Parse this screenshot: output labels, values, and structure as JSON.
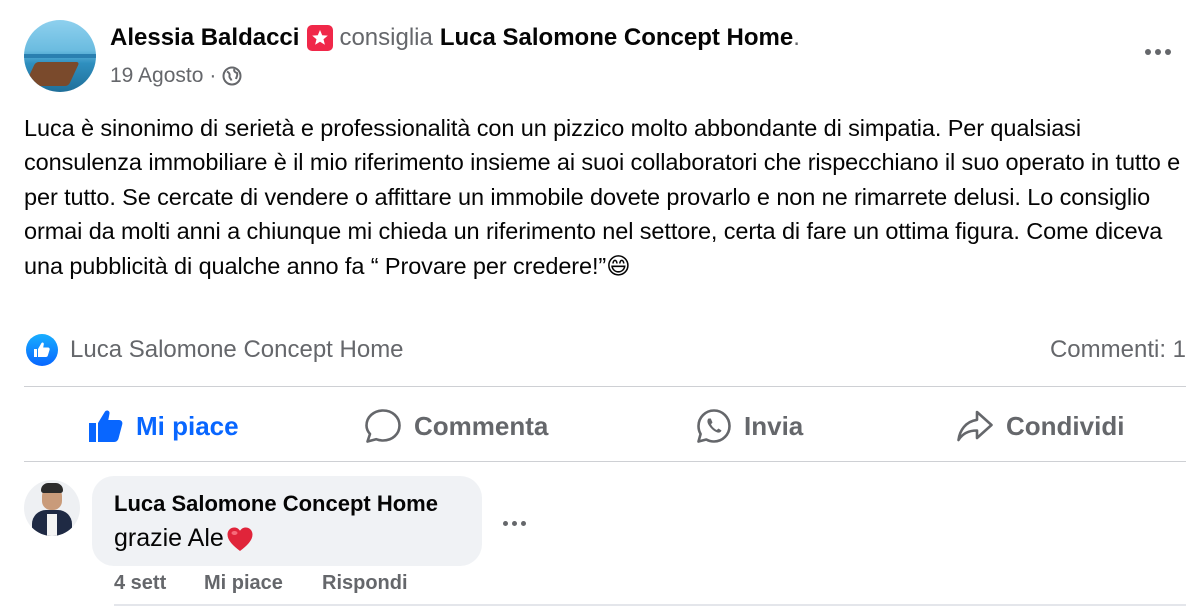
{
  "post": {
    "author": "Alessia Baldacci",
    "verb": "consiglia",
    "page": "Luca Salomone Concept Home",
    "trailing_period": ".",
    "date": "19 Agosto",
    "separator": "·",
    "audience_icon": "globe-icon",
    "text": "Luca è sinonimo di serietà e professionalità con un pizzico molto abbondante di simpatia. Per qualsiasi consulenza immobiliare è il mio riferimento insieme ai suoi collaboratori che rispecchiano il suo operato in tutto e per tutto. Se cercate di vendere o affittare un immobile dovete provarlo e non ne rimarrete delusi. Lo consiglio ormai da molti anni a chiunque mi chieda un riferimento nel settore, certa di fare un ottima figura. Come diceva una pubblicità di qualche anno fa “ Provare per credere!”😄"
  },
  "reactions": {
    "reactors": "Luca Salomone Concept Home",
    "comments_count": "Commenti: 1"
  },
  "actions": {
    "like": "Mi piace",
    "comment": "Comment a",
    "send": "Invia",
    "share": "Condividi"
  },
  "comment": {
    "author": "Luca Salomone Concept Home",
    "text": "grazie Ale",
    "emoji": "heart-icon",
    "time": "4 sett",
    "like": "Mi piace",
    "reply": "Rispondi"
  },
  "colors": {
    "accent": "#0866ff",
    "secondary_text": "#65676b",
    "recommend_badge": "#f02849",
    "bubble": "#f0f2f5"
  }
}
